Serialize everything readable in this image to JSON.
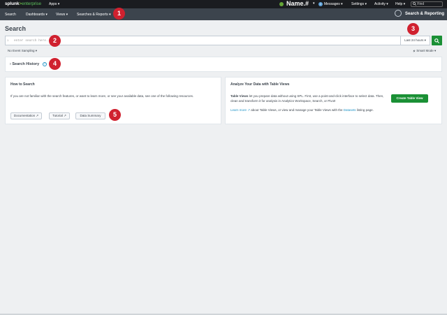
{
  "topbar": {
    "logo_brand": "splunk",
    "logo_gt": ">",
    "logo_product": "enterprise",
    "apps": "Apps ▾",
    "user": "Name.#",
    "user_caret": "▾",
    "messages_count": "2",
    "messages": "Messages ▾",
    "settings": "Settings ▾",
    "activity": "Activity ▾",
    "help": "Help ▾",
    "find_placeholder": "Find"
  },
  "appbar": {
    "nav": [
      "Search",
      "Dashboards ▾",
      "Views ▾",
      "Searches & Reports ▾"
    ],
    "app_name": "Search & Reporting"
  },
  "markers": [
    "1",
    "2",
    "3",
    "4",
    "5"
  ],
  "page": {
    "title": "Search",
    "search_line_number": "1",
    "search_placeholder": "enter search here...",
    "time_range": "Last 24 hours ▾",
    "event_sampling": "No Event Sampling ▾",
    "mode": "Smart Mode ▾",
    "history_label": "Search History",
    "history_help": "?"
  },
  "how_to": {
    "title": "How to Search",
    "description": "If you are not familiar with the search features, or want to learn more, or see your available data, see one of the following resources.",
    "buttons": [
      "Documentation ↗",
      "Tutorial ↗",
      "Data Summary"
    ]
  },
  "table_views": {
    "title": "Analyze Your Data with Table Views",
    "lead": "Table Views",
    "desc": " let you prepare data without using SPL. First, use a point-and-click interface to select data. Then, clean and transform it for analysis in Analytics Workspace, Search, or Pivot!",
    "learn_more": "Learn more ↗",
    "desc2": " about Table Views, or view and manage your Table Views with the ",
    "datasets_link": "Datasets",
    "desc3": " listing page.",
    "create_button": "Create Table View"
  },
  "colors": {
    "topbar": "#1a1c20",
    "appbar": "#3c444d",
    "accent_green": "#1a9035",
    "marker_red": "#d0212f",
    "link_blue": "#1e93c6"
  }
}
